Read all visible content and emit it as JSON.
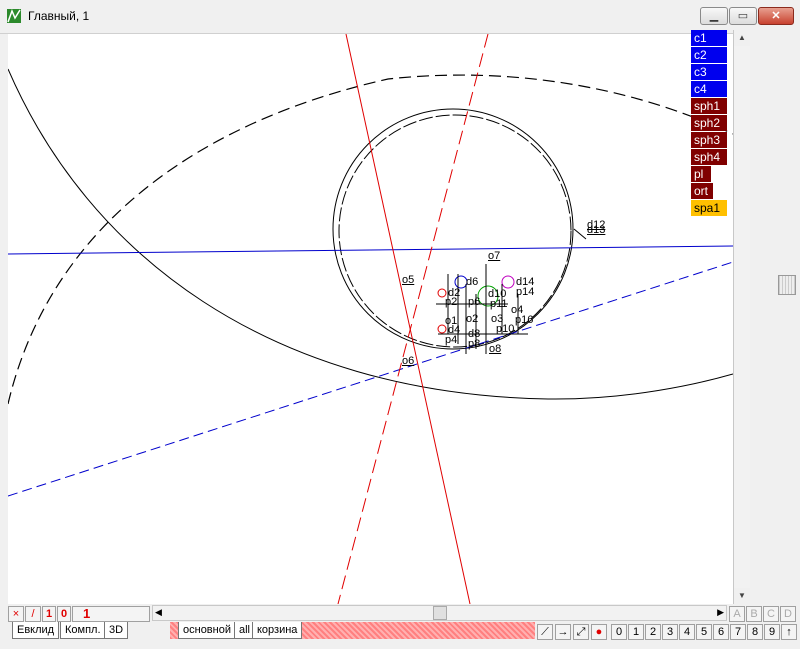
{
  "window": {
    "title": "Главный, 1"
  },
  "legend": [
    {
      "label": "c1",
      "color": "#0000ee"
    },
    {
      "label": "c2",
      "color": "#0000ee"
    },
    {
      "label": "c3",
      "color": "#0000ee"
    },
    {
      "label": "c4",
      "color": "#0000ee"
    },
    {
      "label": "sph1",
      "color": "#800000"
    },
    {
      "label": "sph2",
      "color": "#800000"
    },
    {
      "label": "sph3",
      "color": "#800000"
    },
    {
      "label": "sph4",
      "color": "#800000"
    },
    {
      "label": "pl",
      "color": "#800000"
    },
    {
      "label": "ort",
      "color": "#800000"
    },
    {
      "label": "spa1",
      "color": "#ffc000"
    }
  ],
  "canvas_labels": {
    "o5": "o5",
    "o6": "o6",
    "o7": "o7",
    "o8": "o8",
    "o1": "o1",
    "o2": "o2",
    "o3": "o3",
    "o4": "o4",
    "d12": "d12",
    "d13": "d13",
    "d6": "d6",
    "d14": "d14",
    "d2": "d2",
    "d10": "d10",
    "d4": "d4",
    "d8": "d8",
    "p2": "p2",
    "p4": "p4",
    "p6": "p6",
    "p8": "p8",
    "p11": "p11",
    "p14": "p14",
    "p16": "p16",
    "p10": "p10"
  },
  "bottom_bar": {
    "icon_x": "×",
    "icon_slash": "/",
    "num1": "1",
    "num0": "0",
    "counter": "1",
    "tabs_left": [
      "Евклид",
      "Компл.",
      "3D"
    ],
    "tabs_mid": [
      "основной",
      "all",
      "корзина"
    ],
    "letters": [
      "A",
      "B",
      "C",
      "D"
    ],
    "digits": [
      "0",
      "1",
      "2",
      "3",
      "4",
      "5",
      "6",
      "7",
      "8",
      "9"
    ],
    "up_arrow": "↑",
    "tool_arrow": "→"
  }
}
